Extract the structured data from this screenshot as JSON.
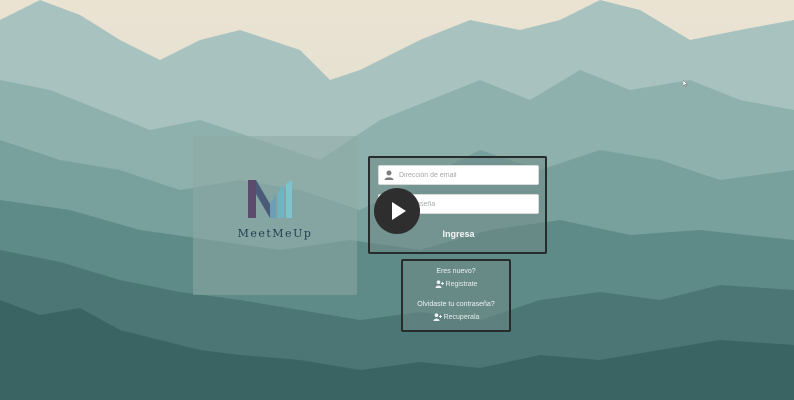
{
  "brand": {
    "name": "MeetMeUp"
  },
  "login": {
    "email_placeholder": "Dirección de email",
    "password_placeholder": "Contraseña",
    "submit_label": "Ingresa"
  },
  "signup": {
    "question": "Eres nuevo?",
    "link_label": "Registrate"
  },
  "recover": {
    "question": "Olvidaste tu contraseña?",
    "link_label": "Recuperala"
  },
  "colors": {
    "sky": "#e8e2d4",
    "mountain_dark": "#3f6b6a",
    "panel": "#8eaaa6",
    "border": "#252c2b",
    "brand_purple": "#5a4c6a",
    "brand_teal": "#6fb4c4"
  },
  "icons": {
    "user": "user-icon",
    "lock": "lock-icon",
    "play": "play-icon",
    "add_user": "add-user-icon"
  }
}
